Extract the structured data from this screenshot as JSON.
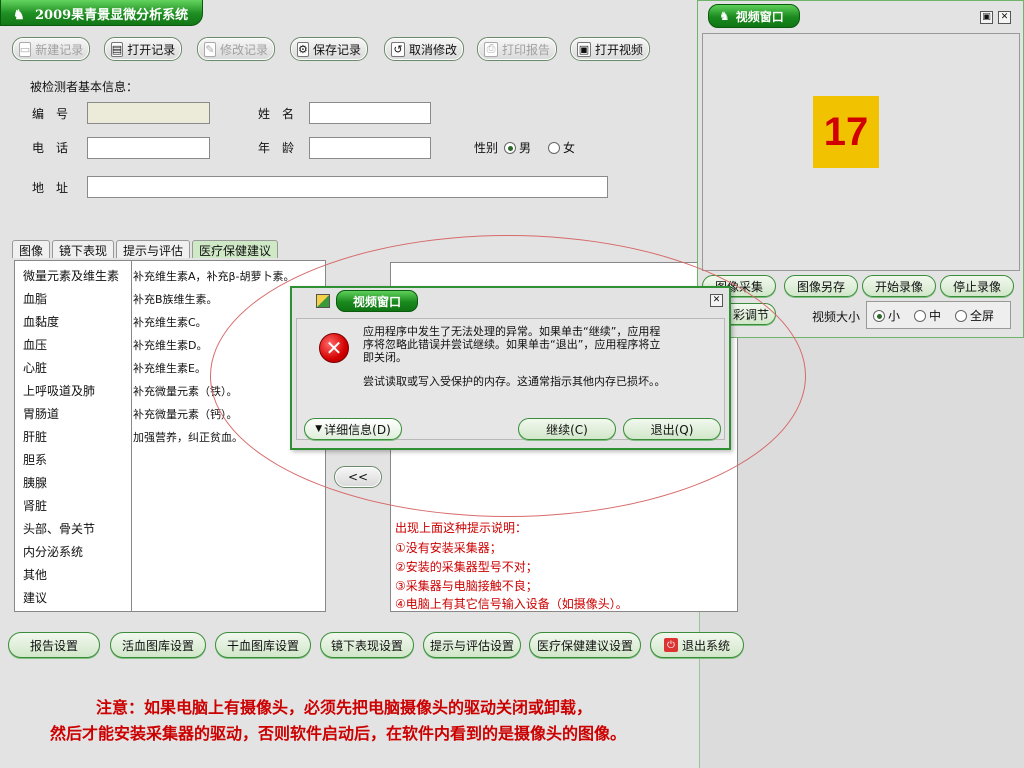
{
  "main": {
    "title": "2009果青景显微分析系统",
    "toolbar": [
      {
        "label": "新建记录",
        "icon": "new-record-icon",
        "enabled": false
      },
      {
        "label": "打开记录",
        "icon": "folder-open-icon",
        "enabled": true
      },
      {
        "label": "修改记录",
        "icon": "edit-icon",
        "enabled": false
      },
      {
        "label": "保存记录",
        "icon": "save-icon",
        "enabled": true
      },
      {
        "label": "取消修改",
        "icon": "undo-icon",
        "enabled": true
      },
      {
        "label": "打印报告",
        "icon": "print-icon",
        "enabled": false
      },
      {
        "label": "打开视频",
        "icon": "video-icon",
        "enabled": true
      }
    ],
    "form": {
      "section_label": "被检测者基本信息：",
      "id_label": "编　号",
      "name_label": "姓　名",
      "phone_label": "电　话",
      "age_label": "年　龄",
      "gender_label": "性别",
      "gender_male": "男",
      "gender_female": "女",
      "gender_selected": "男",
      "address_label": "地　址",
      "id_value": "",
      "name_value": "",
      "phone_value": "",
      "age_value": "",
      "address_value": ""
    },
    "tabs": [
      "图像",
      "镜下表现",
      "提示与评估",
      "医疗保健建议"
    ],
    "active_tab": "医疗保健建议",
    "categories": [
      "微量元素及维生素",
      "血脂",
      "血黏度",
      "血压",
      "心脏",
      "上呼吸道及肺",
      "胃肠道",
      "肝脏",
      "胆系",
      "胰腺",
      "肾脏",
      "头部、骨关节",
      "内分泌系统",
      "其他",
      "建议"
    ],
    "advice": [
      "补充维生素A，补充β-胡萝卜素。",
      "补充B族维生素。",
      "补充维生素C。",
      "补充维生素D。",
      "补充维生素E。",
      "补充微量元素（铁）。",
      "补充微量元素（钙）。",
      "加强营养，纠正贫血。"
    ],
    "move_back_label": "<<",
    "notes": [
      "出现上面这种提示说明：",
      "①没有安装采集器；",
      "②安装的采集器型号不对；",
      "③采集器与电脑接触不良；",
      "④电脑上有其它信号输入设备（如摄像头）。"
    ],
    "bottom_buttons": [
      "报告设置",
      "活血图库设置",
      "干血图库设置",
      "镜下表现设置",
      "提示与评估设置",
      "医疗保健建议设置",
      "退出系统"
    ]
  },
  "video": {
    "title": "视频窗口",
    "badge": "17",
    "buttons": [
      "图像采集",
      "图像另存",
      "开始录像",
      "停止录像"
    ],
    "color_adjust_label": "色彩调节",
    "color_adjust_visible": "彩调节",
    "size_label": "视频大小",
    "size_options": [
      "小",
      "中",
      "全屏"
    ],
    "size_selected": "小"
  },
  "dialog": {
    "title": "视频窗口",
    "message_lines": [
      "应用程序中发生了无法处理的异常。如果单击“继续”，应用程",
      "序将忽略此错误并尝试继续。如果单击“退出”，应用程序将立",
      "即关闭。"
    ],
    "detail_line": "尝试读取或写入受保护的内存。这通常指示其他内存已损坏。。",
    "details_button": "详细信息(D)",
    "continue_button": "继续(C)",
    "quit_button": "退出(Q)"
  },
  "bottom_warning": [
    "注意：如果电脑上有摄像头，必须先把电脑摄像头的驱动关闭或卸载，",
    "然后才能安装采集器的驱动，否则软件启动后，在软件内看到的是摄像头的图像。"
  ],
  "colors": {
    "accent_green": "#1e8d22",
    "error_red": "#cc0000",
    "badge_yellow": "#f0c200"
  }
}
